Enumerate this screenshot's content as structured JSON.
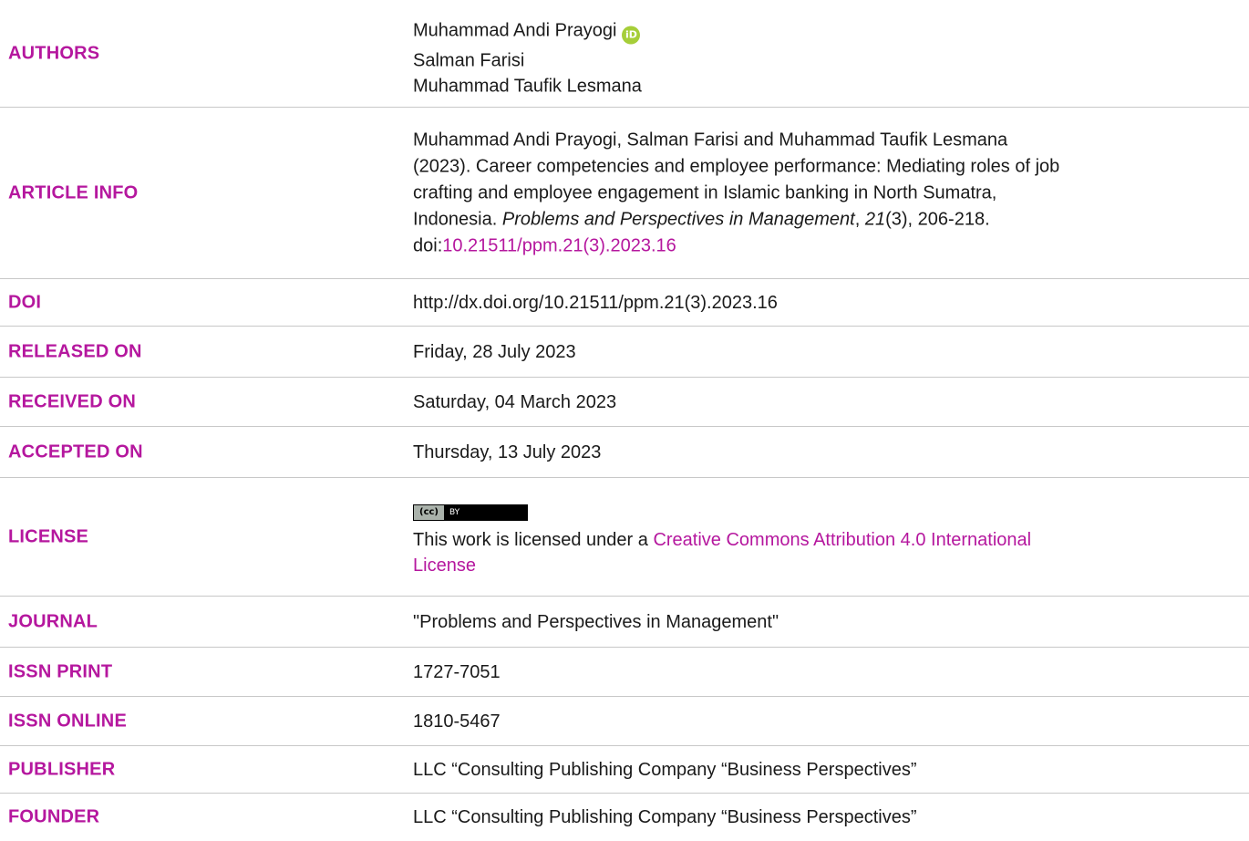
{
  "rows": {
    "authors": {
      "label": "AUTHORS",
      "names": [
        "Muhammad Andi Prayogi",
        "Salman Farisi",
        "Muhammad Taufik Lesmana"
      ],
      "orcid_icon": "orcid-icon"
    },
    "article_info": {
      "label": "ARTICLE INFO",
      "line1": "Muhammad Andi Prayogi, Salman Farisi and Muhammad Taufik Lesmana",
      "line2": "(2023). Career competencies and employee performance: Mediating roles of job",
      "line3": "crafting and employee engagement in Islamic banking in North Sumatra,",
      "line4_pre": "Indonesia. ",
      "journal_italic": "Problems and Perspectives in Management",
      "sep": ", ",
      "volume_italic": "21",
      "issue_pages": "(3), 206-218.",
      "doi_prefix": "doi:",
      "doi_link": "10.21511/ppm.21(3).2023.16"
    },
    "doi": {
      "label": "DOI",
      "value": "http://dx.doi.org/10.21511/ppm.21(3).2023.16"
    },
    "released": {
      "label": "RELEASED ON",
      "value": "Friday, 28 July 2023"
    },
    "received": {
      "label": "RECEIVED ON",
      "value": "Saturday, 04 March 2023"
    },
    "accepted": {
      "label": "ACCEPTED ON",
      "value": "Thursday, 13 July 2023"
    },
    "license": {
      "label": "LICENSE",
      "badge_cc": "(cc)",
      "badge_by": "BY",
      "text_pre": "This work is licensed under a ",
      "link_line1": "Creative Commons Attribution 4.0 International",
      "link_line2": "License"
    },
    "journal": {
      "label": "JOURNAL",
      "value": "\"Problems and Perspectives in Management\""
    },
    "issn_print": {
      "label": "ISSN PRINT",
      "value": "1727-7051"
    },
    "issn_online": {
      "label": "ISSN ONLINE",
      "value": "1810-5467"
    },
    "publisher": {
      "label": "PUBLISHER",
      "value": "LLC “Consulting Publishing Company “Business Perspectives”"
    },
    "founder": {
      "label": "FOUNDER",
      "value": "LLC “Consulting Publishing Company “Business Perspectives”"
    }
  },
  "colors": {
    "label": "#b5179e",
    "link": "#b5179e",
    "divider": "#c8c8c8",
    "orcid": "#a6ce39"
  }
}
